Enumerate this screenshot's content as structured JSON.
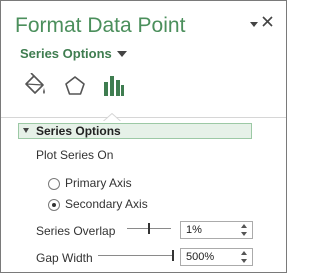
{
  "pane": {
    "title": "Format Data Point",
    "options_dropdown": "Series Options"
  },
  "tabs": [
    {
      "name": "fill-line",
      "icon": "paint-bucket-icon",
      "selected": false
    },
    {
      "name": "effects",
      "icon": "pentagon-icon",
      "selected": false
    },
    {
      "name": "series-options",
      "icon": "bar-chart-icon",
      "selected": true
    }
  ],
  "section": {
    "header": "Series Options",
    "expanded": true,
    "plot_series_on_label": "Plot Series On",
    "axis_options": [
      {
        "label": "Primary Axis",
        "selected": false
      },
      {
        "label": "Secondary Axis",
        "selected": true
      }
    ],
    "series_overlap": {
      "label": "Series Overlap",
      "value": "1%",
      "percent": 1,
      "min": -100,
      "max": 100
    },
    "gap_width": {
      "label": "Gap Width",
      "value": "500%",
      "percent": 500,
      "min": 0,
      "max": 500
    }
  },
  "colors": {
    "title": "#4b8f5c",
    "accent": "#3f7d50",
    "section_bg": "#e6f1e8",
    "section_border": "#9cc9a5"
  }
}
